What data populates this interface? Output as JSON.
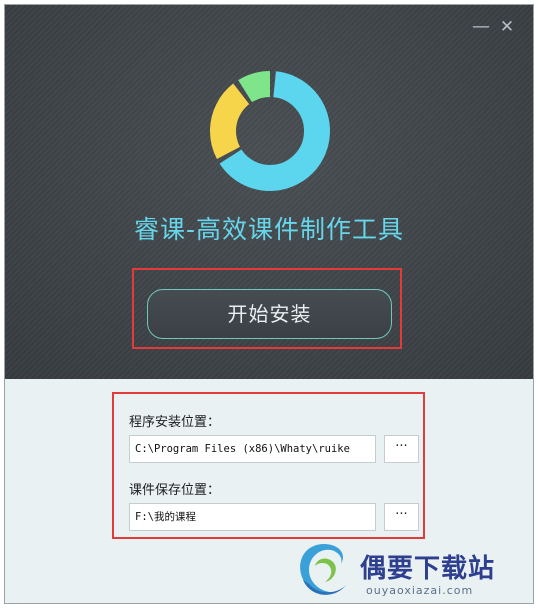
{
  "window": {
    "minimize_glyph": "—",
    "close_glyph": "✕"
  },
  "header": {
    "title": "睿课-高效课件制作工具",
    "logo_icon": "donut-ring-logo",
    "logo_colors": {
      "blue": "#5bd6ee",
      "yellow": "#f7d54b",
      "green": "#7ee58b"
    }
  },
  "install": {
    "label": "开始安装"
  },
  "fields": {
    "program_location": {
      "label": "程序安装位置：",
      "value": "C:\\Program Files (x86)\\Whaty\\ruike",
      "browse_label": "···"
    },
    "course_save_location": {
      "label": "课件保存位置：",
      "value": "F:\\我的课程",
      "browse_label": "···"
    }
  },
  "watermark": {
    "name": "偶要下载站",
    "url": "ouyaoxiazai.com"
  },
  "colors": {
    "accent": "#66d6ea",
    "highlight": "#e33a3a",
    "button_border": "#6fc7bd",
    "dark_bg": "#41464b",
    "light_bg": "#eaf1f3"
  }
}
